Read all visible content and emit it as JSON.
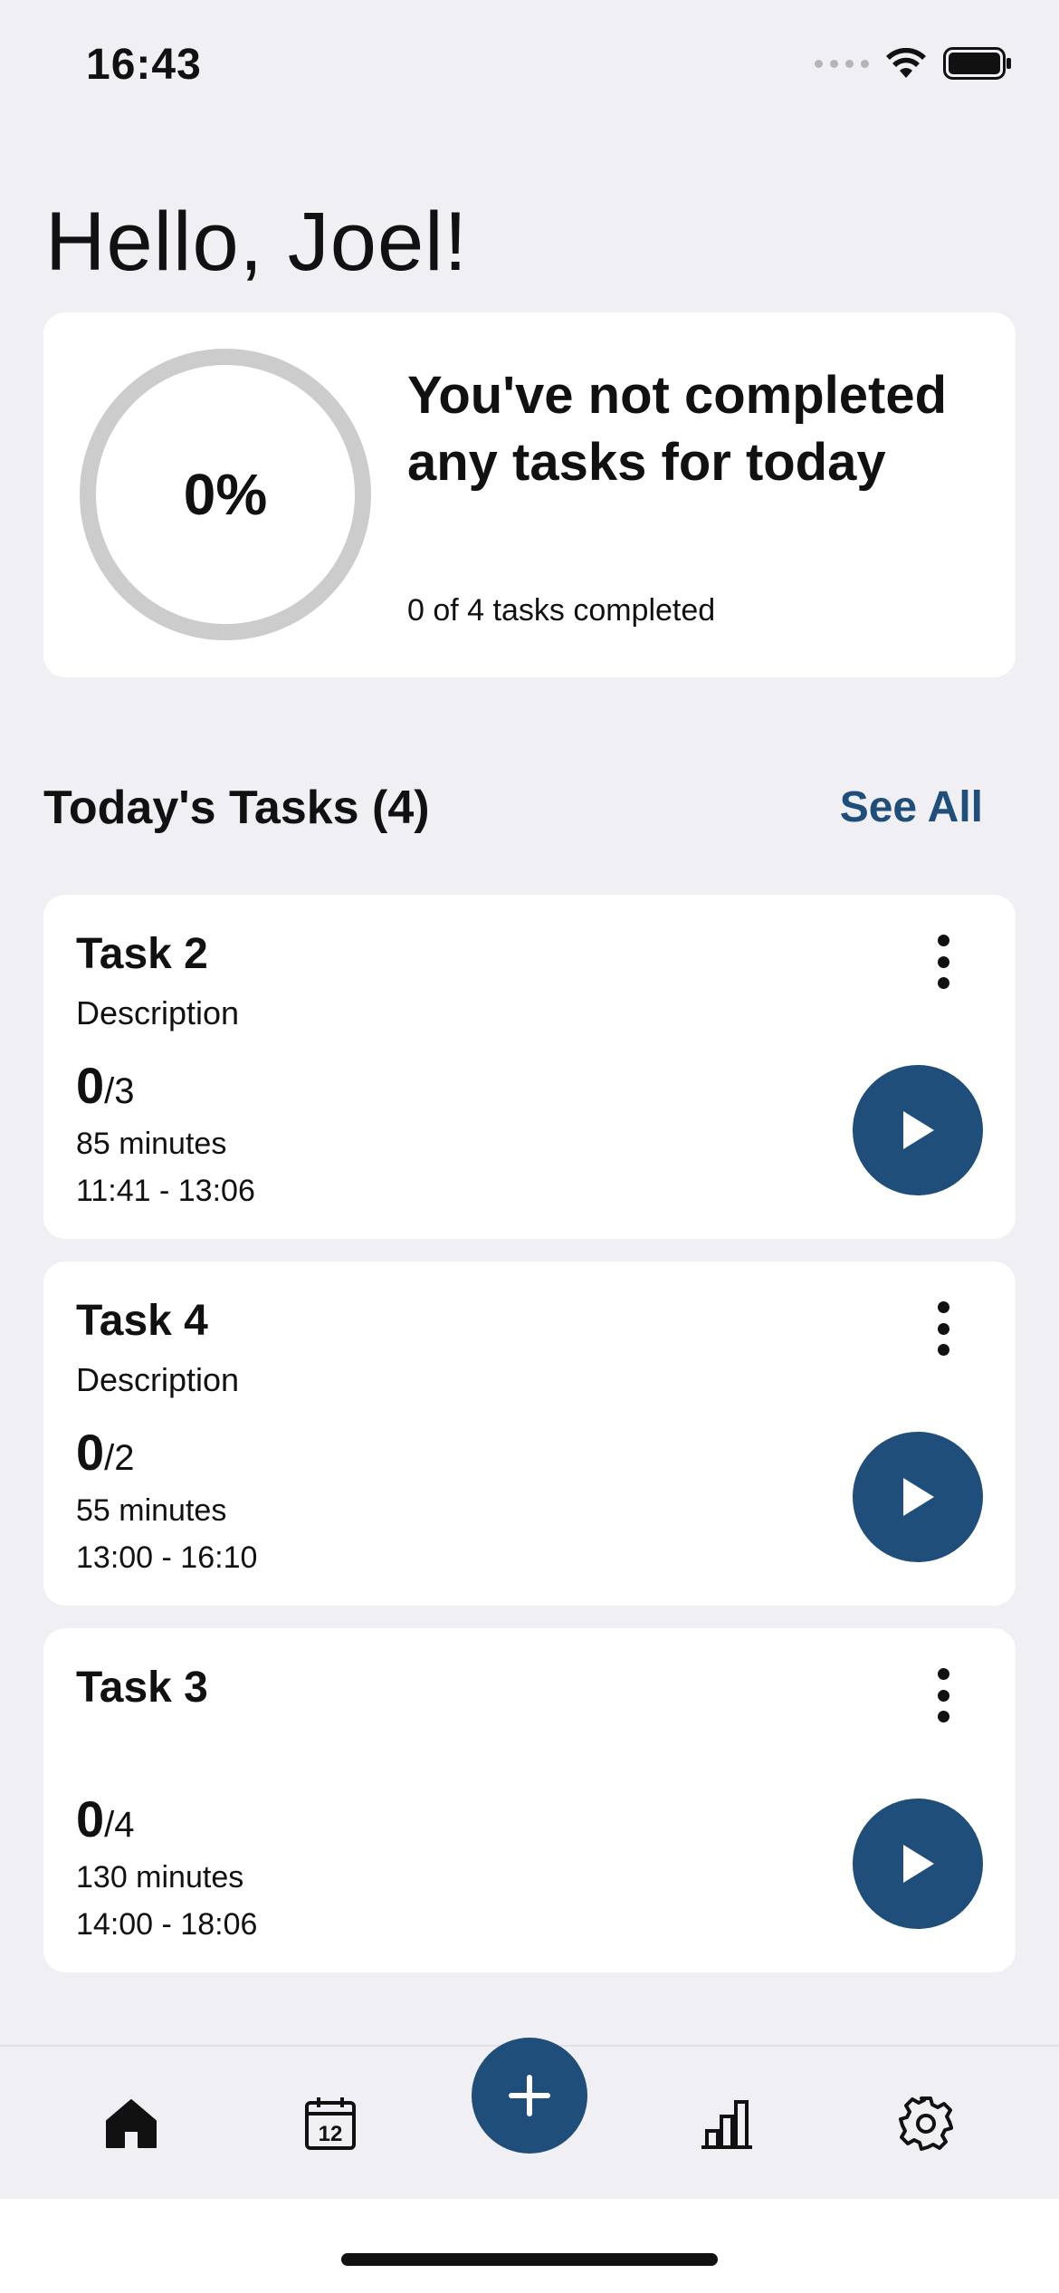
{
  "status_bar": {
    "time": "16:43",
    "wifi_icon": "wifi-icon",
    "battery_icon": "battery-icon"
  },
  "greeting": "Hello, Joel!",
  "progress": {
    "percent_label": "0%",
    "percent_value": 0,
    "title": "You've not completed any tasks for today",
    "subtitle": "0 of 4 tasks completed"
  },
  "tasks_section": {
    "title": "Today's Tasks (4)",
    "see_all": "See All"
  },
  "tasks": [
    {
      "title": "Task 2",
      "description": "Description",
      "done": "0",
      "total": "/3",
      "minutes": "85 minutes",
      "time": "11:41 - 13:06"
    },
    {
      "title": "Task 4",
      "description": "Description",
      "done": "0",
      "total": "/2",
      "minutes": "55 minutes",
      "time": "13:00 - 16:10"
    },
    {
      "title": "Task 3",
      "description": "",
      "done": "0",
      "total": "/4",
      "minutes": "130 minutes",
      "time": "14:00 - 18:06"
    }
  ],
  "tab_bar": {
    "icons": [
      "home-icon",
      "calendar-icon",
      "plus-icon",
      "stats-icon",
      "settings-icon"
    ],
    "calendar_day": "12"
  },
  "colors": {
    "accent": "#1f4e7a",
    "background": "#f0eff4",
    "ring": "#cccccc"
  }
}
